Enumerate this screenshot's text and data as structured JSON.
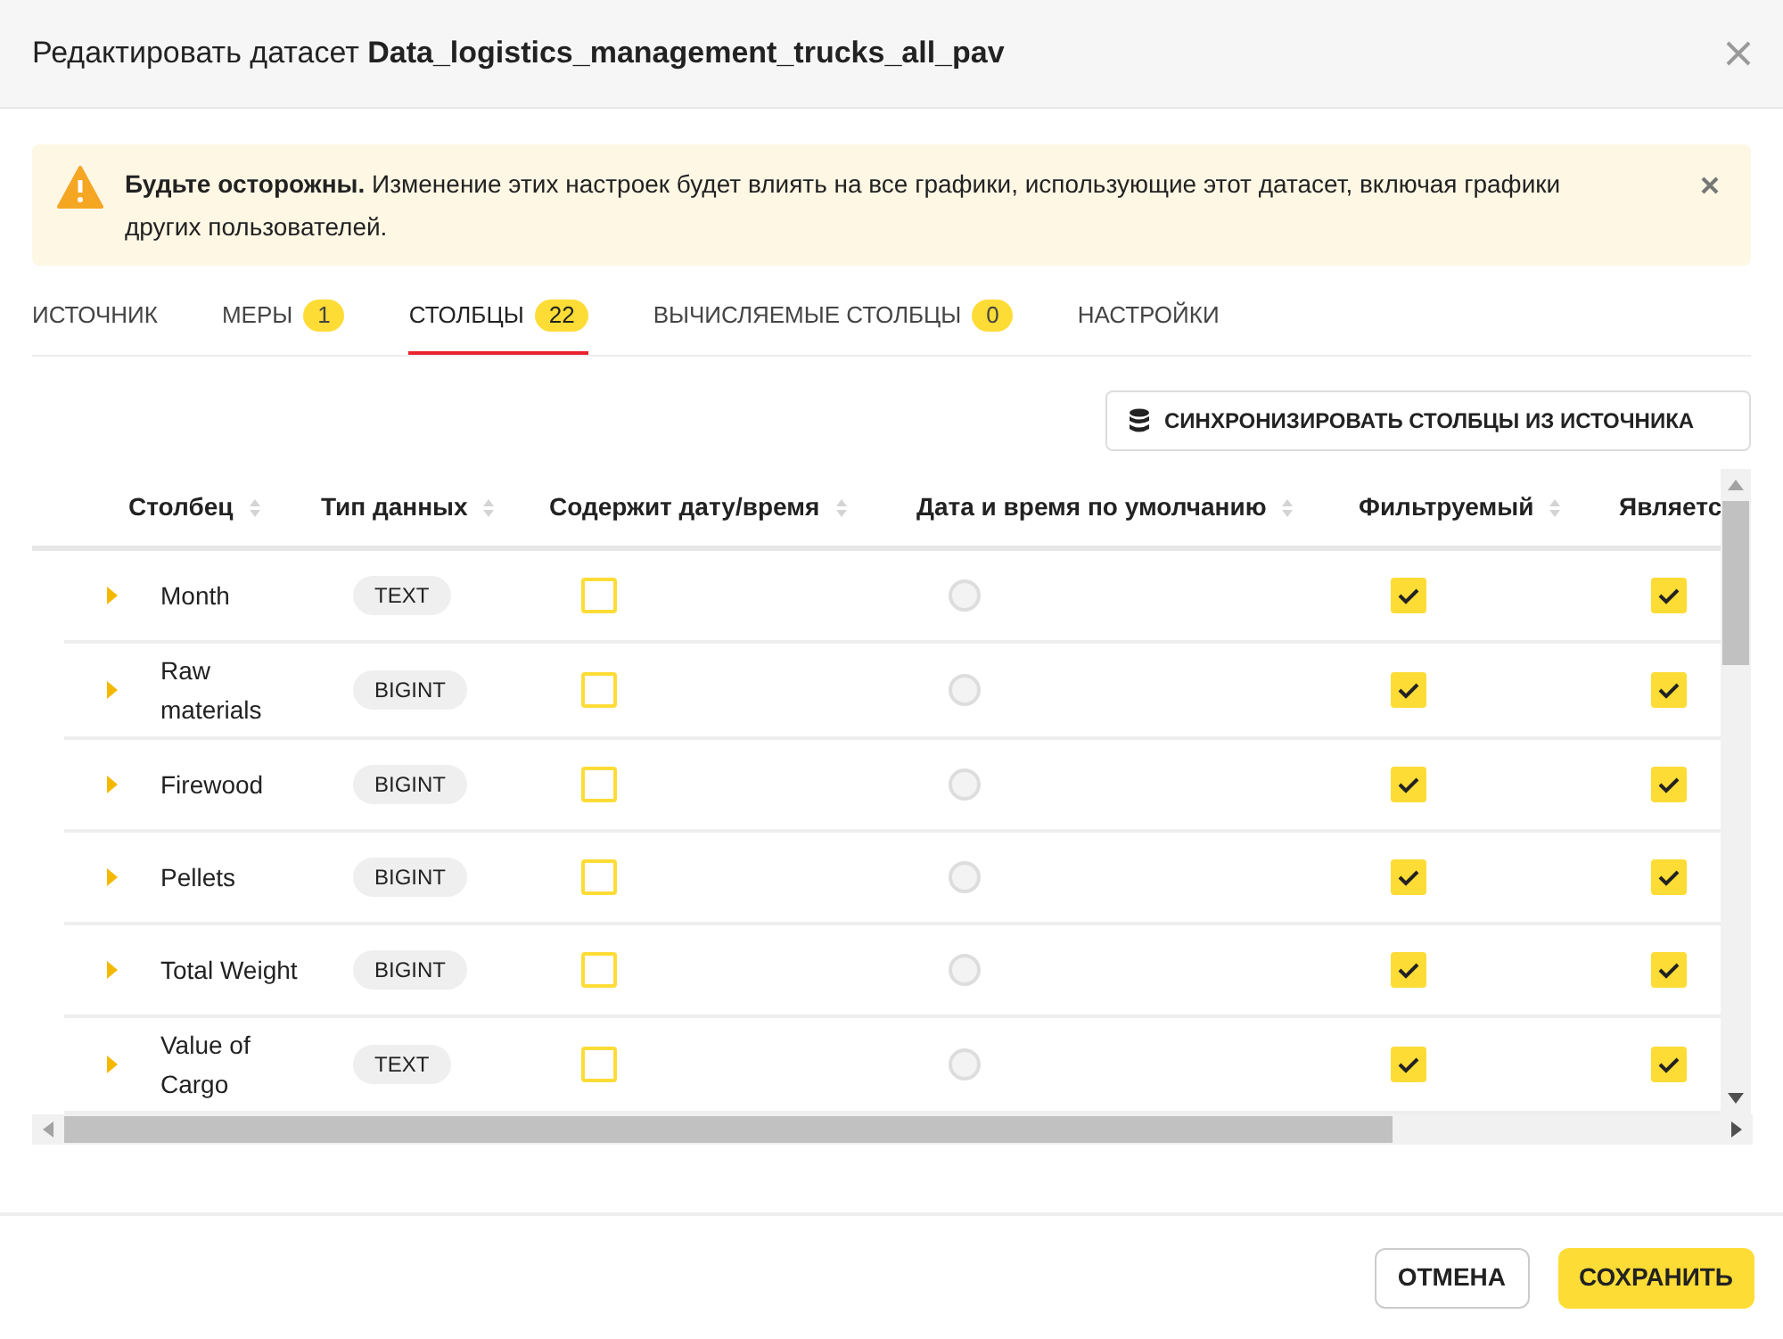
{
  "dialog": {
    "title_prefix": "Редактировать датасет",
    "title_name": "Data_logistics_management_trucks_all_pav"
  },
  "warning": {
    "text": "**Будьте осторожны.** Изменение этих настроек будет влиять на все графики, использующие этот датасет, включая графики других пользователей."
  },
  "tabs": [
    {
      "label": "ИСТОЧНИК",
      "selected": false
    },
    {
      "label": "МЕРЫ",
      "count": "1",
      "selected": false
    },
    {
      "label": "СТОЛБЦЫ",
      "count": "22",
      "selected": true
    },
    {
      "label": "ВЫЧИСЛЯЕМЫЕ СТОЛБЦЫ",
      "count": "0",
      "selected": false
    },
    {
      "label": "НАСТРОЙКИ",
      "selected": false
    }
  ],
  "sync_button": "СИНХРОНИЗИРОВАТЬ СТОЛБЦЫ ИЗ ИСТОЧНИКА",
  "table": {
    "columns": [
      {
        "label": "Столбец",
        "sortable": true
      },
      {
        "label": "Тип данных",
        "sortable": true
      },
      {
        "label": "Содержит дату/время",
        "sortable": true
      },
      {
        "label": "Дата и время по умолчанию",
        "sortable": true
      },
      {
        "label": "Фильтруемый",
        "sortable": true
      },
      {
        "label": "Являетс",
        "sortable": false
      }
    ],
    "rows": [
      {
        "name": "Month",
        "type": "TEXT",
        "contains_datetime": false,
        "default_datetime": false,
        "filterable": true,
        "column_6": true
      },
      {
        "name": "Raw materials",
        "type": "BIGINT",
        "contains_datetime": false,
        "default_datetime": false,
        "filterable": true,
        "column_6": true
      },
      {
        "name": "Firewood",
        "type": "BIGINT",
        "contains_datetime": false,
        "default_datetime": false,
        "filterable": true,
        "column_6": true
      },
      {
        "name": "Pellets",
        "type": "BIGINT",
        "contains_datetime": false,
        "default_datetime": false,
        "filterable": true,
        "column_6": true
      },
      {
        "name": "Total Weight",
        "type": "BIGINT",
        "contains_datetime": false,
        "default_datetime": false,
        "filterable": true,
        "column_6": true
      },
      {
        "name": "Value of Cargo",
        "type": "TEXT",
        "contains_datetime": false,
        "default_datetime": false,
        "filterable": true,
        "column_6": true
      }
    ]
  },
  "footer": {
    "cancel": "ОТМЕНА",
    "save": "СОХРАНИТЬ"
  }
}
